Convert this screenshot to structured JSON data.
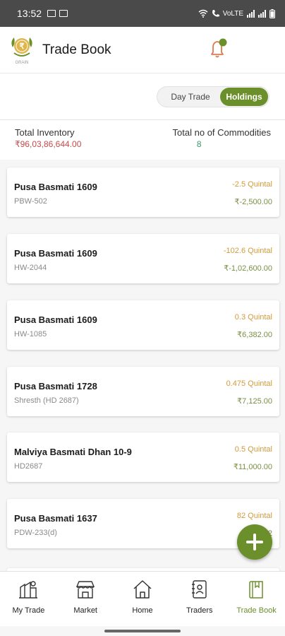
{
  "status_bar": {
    "time": "13:52",
    "network": "VoLTE"
  },
  "app_bar": {
    "title": "Trade Book",
    "logo_text": "GRAIN"
  },
  "toggle": {
    "day_trade": "Day Trade",
    "holdings": "Holdings",
    "selected": "Holdings"
  },
  "summary": {
    "inventory_label": "Total Inventory",
    "inventory_value": "₹96,03,86,644.00",
    "commodities_label": "Total no of Commodities",
    "commodities_value": "8"
  },
  "cards": [
    {
      "name": "Pusa Basmati 1609",
      "code": "PBW-502",
      "qty": "-2.5 Quintal",
      "amount": "₹-2,500.00"
    },
    {
      "name": "Pusa Basmati 1609",
      "code": "HW-2044",
      "qty": "-102.6 Quintal",
      "amount": "₹-1,02,600.00"
    },
    {
      "name": "Pusa Basmati 1609",
      "code": "HW-1085",
      "qty": "0.3 Quintal",
      "amount": "₹6,382.00"
    },
    {
      "name": "Pusa Basmati 1728",
      "code": "Shresth (HD 2687)",
      "qty": "0.475 Quintal",
      "amount": "₹7,125.00"
    },
    {
      "name": "Malviya Basmati Dhan 10-9",
      "code": "HD2687",
      "qty": "0.5 Quintal",
      "amount": "₹11,000.00"
    },
    {
      "name": "Pusa Basmati 1637",
      "code": "PDW-233(d)",
      "qty": "82 Quintal",
      "amount": "₹8,2"
    }
  ],
  "fab": {
    "icon": "plus-icon"
  },
  "bottom_nav": [
    {
      "label": "My Trade",
      "icon": "my-trade-icon"
    },
    {
      "label": "Market",
      "icon": "market-icon"
    },
    {
      "label": "Home",
      "icon": "home-icon"
    },
    {
      "label": "Traders",
      "icon": "traders-icon"
    },
    {
      "label": "Trade Book",
      "icon": "trade-book-icon",
      "active": true
    }
  ],
  "colors": {
    "accent": "#6b8f2b",
    "negative": "#c94a4a",
    "qty": "#d19b3c",
    "statusbar": "#4a4a4a"
  }
}
